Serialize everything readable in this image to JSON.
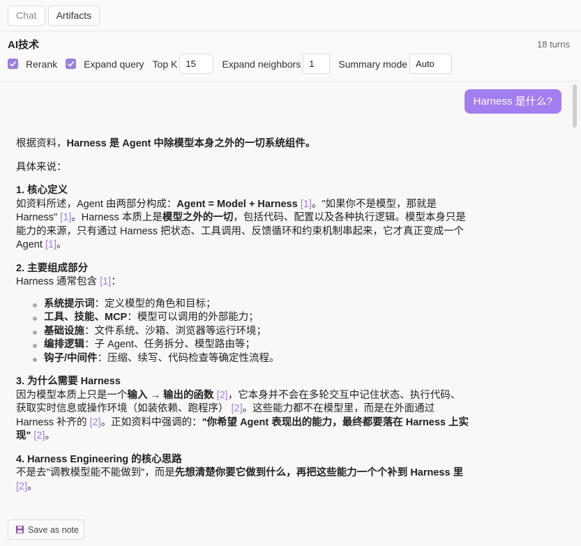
{
  "tabs": [
    {
      "label": "Chat",
      "active": false
    },
    {
      "label": "Artifacts",
      "active": true
    }
  ],
  "header": {
    "title": "AI技术",
    "turns": "18 turns"
  },
  "controls": {
    "rerank_label": "Rerank",
    "rerank_checked": true,
    "expand_query_label": "Expand query",
    "expand_query_checked": true,
    "topk_label": "Top K",
    "topk_value": "15",
    "neighbors_label": "Expand neighbors",
    "neighbors_value": "1",
    "summary_label": "Summary mode",
    "summary_value": "Auto"
  },
  "chat": {
    "user_message": "Harness 是什么?",
    "answer": {
      "intro_prefix": "根据资料，",
      "intro_bold": "Harness 是 Agent 中除模型本身之外的一切系统组件。",
      "lead": "具体来说：",
      "s1_title": "1. 核心定义",
      "s1_a": "如资料所述，Agent 由两部分构成：",
      "s1_b": "Agent = Model + Harness",
      "s1_c": "[1]",
      "s1_d": "。\"如果你不是模型，那就是 Harness\" ",
      "s1_e": "[1]",
      "s1_f": "。Harness 本质上是",
      "s1_g": "模型之外的一切",
      "s1_h": "，包括代码、配置以及各种执行逻辑。模型本身只是能力的来源，只有通过 Harness 把状态、工具调用、反馈循环和约束机制串起来，它才真正变成一个 Agent ",
      "s1_i": "[1]",
      "s1_j": "。",
      "s2_title": "2. 主要组成部分",
      "s2_a": "Harness 通常包含 ",
      "s2_b": "[1]",
      "s2_c": "：",
      "s2_items": [
        {
          "bold": "系统提示词",
          "text": "：定义模型的角色和目标；"
        },
        {
          "bold": "工具、技能、MCP",
          "text": "：模型可以调用的外部能力；"
        },
        {
          "bold": "基础设施",
          "text": "：文件系统、沙箱、浏览器等运行环境；"
        },
        {
          "bold": "编排逻辑",
          "text": "：子 Agent、任务拆分、模型路由等；"
        },
        {
          "bold": "钩子/中间件",
          "text": "：压缩、续写、代码检查等确定性流程。"
        }
      ],
      "s3_title": "3. 为什么需要 Harness",
      "s3_a": "因为模型本质上只是一个",
      "s3_b": "输入 → 输出的函数",
      "s3_c": " [2]",
      "s3_d": "，它本身并不会在多轮交互中记住状态、执行代码、获取实时信息或操作环境（如装依赖、跑程序） ",
      "s3_e": "[2]",
      "s3_f": "。这些能力都不在模型里，而是在外面通过 Harness 补齐的 ",
      "s3_g": "[2]",
      "s3_h": "。正如资料中强调的：",
      "s3_i": "\"你希望 Agent 表现出的能力，最终都要落在 Harness 上实现\"",
      "s3_j": " [2]",
      "s3_k": "。",
      "s4_title": "4. Harness Engineering 的核心思路",
      "s4_a": "不是去\"调教模型能不能做到\"，而是",
      "s4_b": "先想清楚你要它做到什么，再把这些能力一个个补到 Harness 里",
      "s4_c": " [2]",
      "s4_d": "。"
    }
  },
  "footer": {
    "save_label": "Save as note"
  },
  "colors": {
    "accent": "#a27ef0",
    "citation": "#9b80e3",
    "checkbox": "#9b7fe0"
  },
  "icons": {
    "save": "floppy-disk-icon",
    "check": "checkmark-icon"
  }
}
